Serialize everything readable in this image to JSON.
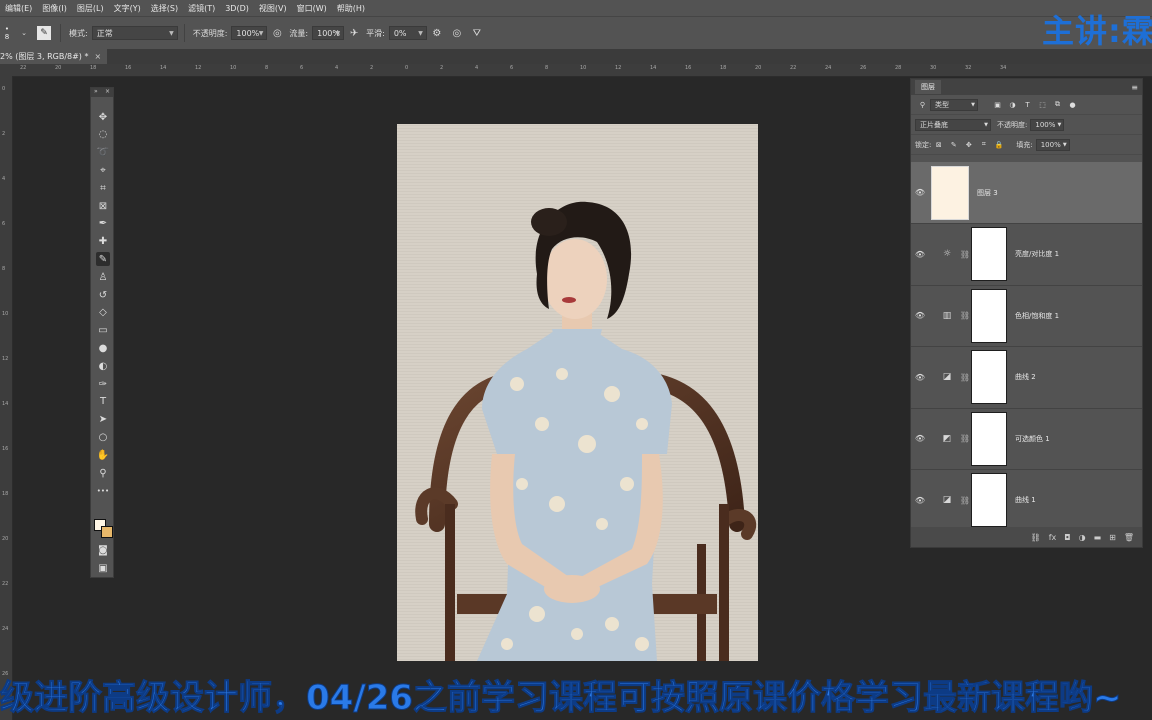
{
  "menubar": {
    "items": [
      "编辑(E)",
      "图像(I)",
      "图层(L)",
      "文字(Y)",
      "选择(S)",
      "滤镜(T)",
      "3D(D)",
      "视图(V)",
      "窗口(W)",
      "帮助(H)"
    ]
  },
  "options": {
    "brush_size": "8",
    "mode_label": "模式:",
    "mode_value": "正常",
    "opacity_label": "不透明度:",
    "opacity_value": "100%",
    "flow_label": "流量:",
    "flow_value": "100%",
    "smooth_label": "平滑:",
    "smooth_value": "0%"
  },
  "document_tab": {
    "title": "2% (图层 3, RGB/8#) *",
    "close": "×"
  },
  "ruler": {
    "h_ticks": [
      "22",
      "20",
      "18",
      "16",
      "14",
      "12",
      "10",
      "8",
      "6",
      "4",
      "2",
      "0",
      "2",
      "4",
      "6",
      "8",
      "10",
      "12",
      "14",
      "16",
      "18",
      "20",
      "22",
      "24",
      "26",
      "28",
      "30",
      "32",
      "34"
    ],
    "v_ticks": [
      "0",
      "2",
      "4",
      "6",
      "8",
      "10",
      "12",
      "14",
      "16",
      "18",
      "20",
      "22",
      "24",
      "26"
    ]
  },
  "toolbox": {
    "tools": [
      {
        "name": "move-tool",
        "glyph": "✥"
      },
      {
        "name": "marquee-tool",
        "glyph": "◌"
      },
      {
        "name": "lasso-tool",
        "glyph": "➰"
      },
      {
        "name": "quick-select-tool",
        "glyph": "⌖"
      },
      {
        "name": "crop-tool",
        "glyph": "⌗"
      },
      {
        "name": "frame-tool",
        "glyph": "⊠"
      },
      {
        "name": "eyedropper-tool",
        "glyph": "✒"
      },
      {
        "name": "healing-brush-tool",
        "glyph": "✚"
      },
      {
        "name": "brush-tool",
        "glyph": "✎"
      },
      {
        "name": "stamp-tool",
        "glyph": "♙"
      },
      {
        "name": "history-brush-tool",
        "glyph": "↺"
      },
      {
        "name": "eraser-tool",
        "glyph": "◇"
      },
      {
        "name": "gradient-tool",
        "glyph": "▭"
      },
      {
        "name": "blur-tool",
        "glyph": "●"
      },
      {
        "name": "dodge-tool",
        "glyph": "◐"
      },
      {
        "name": "pen-tool",
        "glyph": "✑"
      },
      {
        "name": "type-tool",
        "glyph": "T"
      },
      {
        "name": "path-select-tool",
        "glyph": "➤"
      },
      {
        "name": "shape-tool",
        "glyph": "○"
      },
      {
        "name": "hand-tool",
        "glyph": "✋"
      },
      {
        "name": "zoom-tool",
        "glyph": "⚲"
      },
      {
        "name": "more-tools",
        "glyph": "•••"
      }
    ],
    "bottom": [
      {
        "name": "quick-mask-tool",
        "glyph": "◙"
      },
      {
        "name": "screen-mode-tool",
        "glyph": "▣"
      }
    ],
    "foreground_color": "#fff6e6",
    "background_color": "#e8b86a"
  },
  "layers_panel": {
    "tab": "图层",
    "filter_kind": "类型",
    "blend_mode": "正片叠底",
    "opacity_label": "不透明度:",
    "opacity_value": "100%",
    "lock_label": "锁定:",
    "fill_label": "填充:",
    "fill_value": "100%",
    "layers": [
      {
        "name": "图层 3",
        "kind": "fill",
        "adj_icon": "",
        "visible": true,
        "active": true
      },
      {
        "name": "亮度/对比度 1",
        "kind": "adjustment",
        "adj_icon": "☼",
        "visible": true,
        "active": false
      },
      {
        "name": "色相/饱和度 1",
        "kind": "adjustment",
        "adj_icon": "▥",
        "visible": true,
        "active": false
      },
      {
        "name": "曲线 2",
        "kind": "adjustment",
        "adj_icon": "◪",
        "visible": true,
        "active": false
      },
      {
        "name": "可选颜色 1",
        "kind": "adjustment",
        "adj_icon": "◩",
        "visible": true,
        "active": false
      },
      {
        "name": "曲线 1",
        "kind": "adjustment",
        "adj_icon": "◪",
        "visible": true,
        "active": false
      }
    ],
    "bottom_icons": [
      "⛓",
      "fx",
      "◘",
      "◑",
      "▬",
      "⊞",
      "🗑"
    ]
  },
  "overlay": {
    "instructor": "主讲:霖",
    "subtitle": "级进阶高级设计师，04/26之前学习课程可按照原课价格学习最新课程哟~"
  }
}
